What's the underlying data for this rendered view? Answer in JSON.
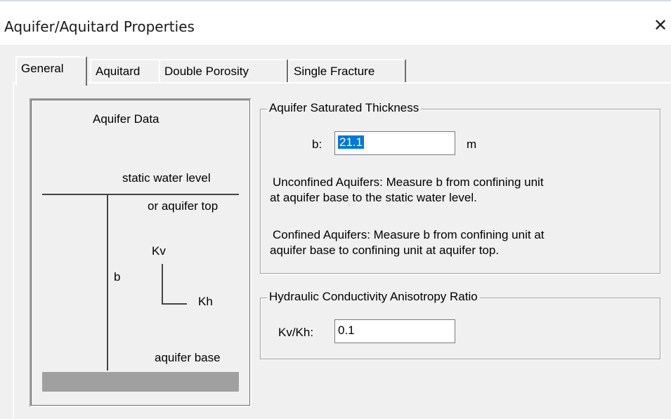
{
  "window": {
    "title": "Aquifer/Aquitard Properties",
    "close_glyph": "✕"
  },
  "tabs": [
    {
      "label": "General",
      "active": true
    },
    {
      "label": "Aquitard",
      "active": false
    },
    {
      "label": "Double Porosity",
      "active": false
    },
    {
      "label": "Single Fracture",
      "active": false
    }
  ],
  "diagram": {
    "heading": "Aquifer Data",
    "static_level": "static water level",
    "aquifer_top": "or aquifer top",
    "kv": "Kv",
    "kh": "Kh",
    "b": "b",
    "aquifer_base": "aquifer base"
  },
  "thickness": {
    "legend": "Aquifer Saturated Thickness",
    "b_label": "b:",
    "b_value": "21.1",
    "unit": "m",
    "unconfined_1": "Unconfined Aquifers:  Measure b from confining unit",
    "unconfined_2": "at aquifer base to the static water level.",
    "confined_1": "Confined Aquifers:  Measure b from confining unit at",
    "confined_2": "aquifer base to confining unit at aquifer top."
  },
  "anisotropy": {
    "legend": "Hydraulic Conductivity Anisotropy Ratio",
    "ratio_label": "Kv/Kh:",
    "ratio_value": "0.1"
  }
}
